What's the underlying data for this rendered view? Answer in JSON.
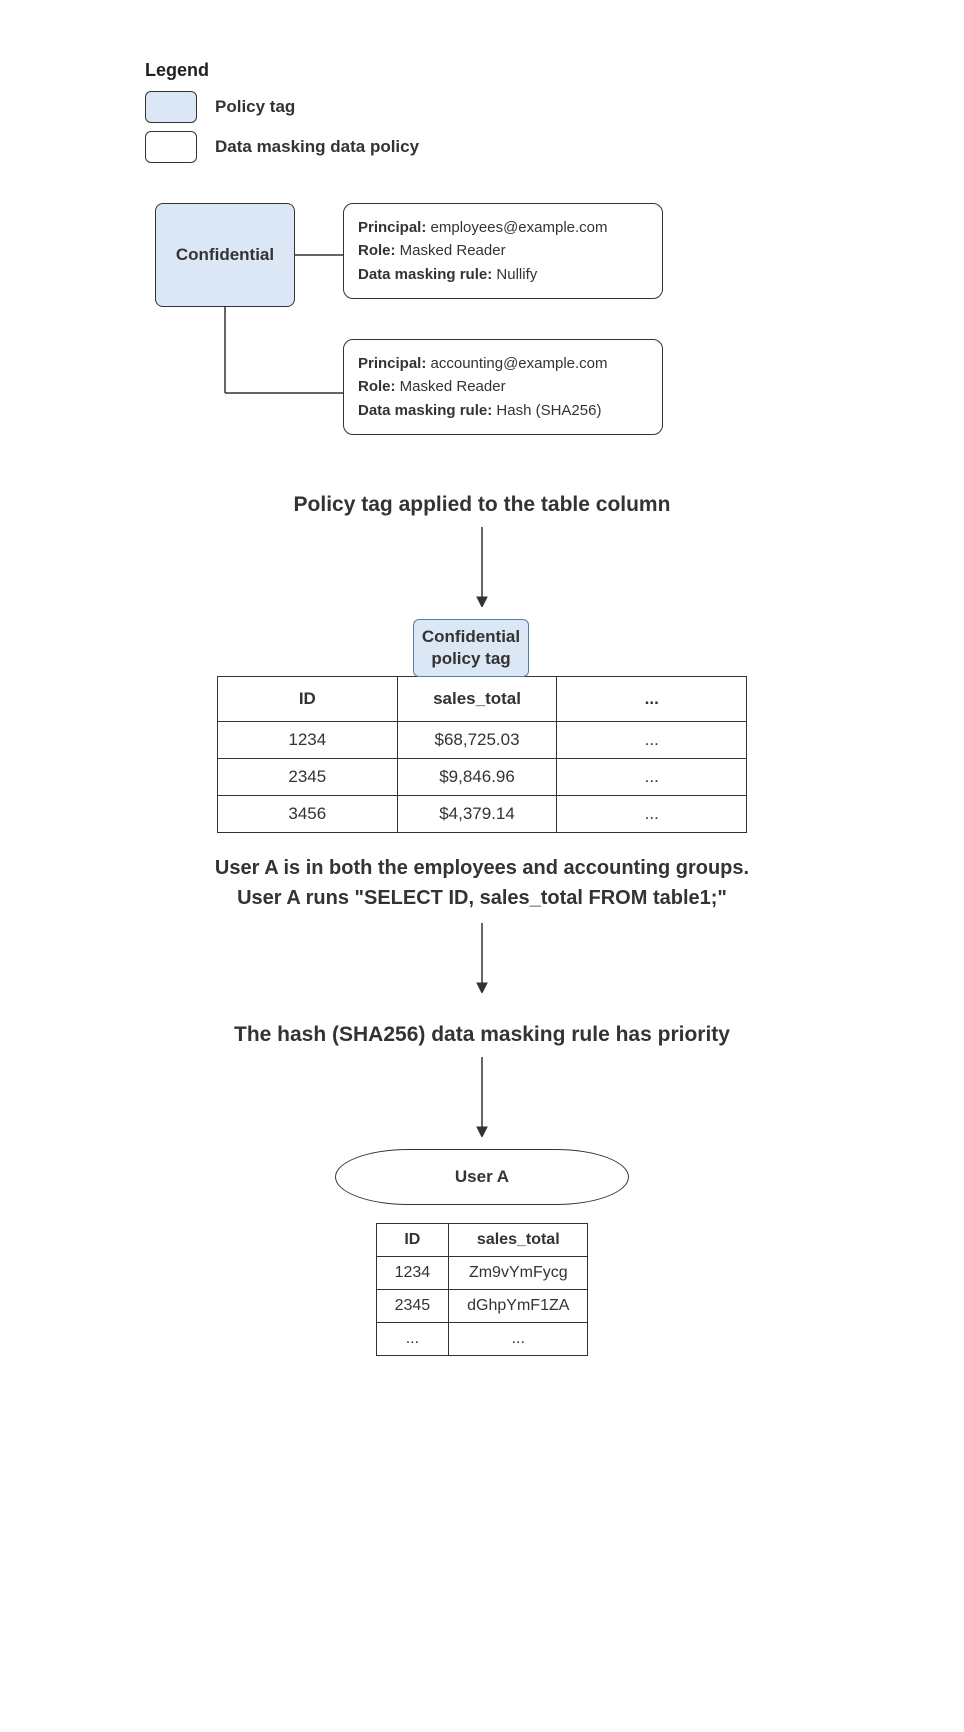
{
  "legend": {
    "title": "Legend",
    "items": [
      {
        "label": "Policy tag",
        "swatch": "blue"
      },
      {
        "label": "Data masking data policy",
        "swatch": "white"
      }
    ]
  },
  "confidential_label": "Confidential",
  "policies": [
    {
      "principal_label": "Principal:",
      "principal": "employees@example.com",
      "role_label": "Role:",
      "role": "Masked Reader",
      "rule_label": "Data masking rule:",
      "rule": "Nullify"
    },
    {
      "principal_label": "Principal:",
      "principal": "accounting@example.com",
      "role_label": "Role:",
      "role": "Masked Reader",
      "rule_label": "Data masking rule:",
      "rule": "Hash (SHA256)"
    }
  ],
  "heading1": "Policy tag applied to the table column",
  "column_tag_line1": "Confidential",
  "column_tag_line2": "policy tag",
  "table1": {
    "headers": [
      "ID",
      "sales_total",
      "..."
    ],
    "rows": [
      [
        "1234",
        "$68,725.03",
        "..."
      ],
      [
        "2345",
        "$9,846.96",
        "..."
      ],
      [
        "3456",
        "$4,379.14",
        "..."
      ]
    ]
  },
  "text_block_line1": "User A is in both the employees and accounting groups.",
  "text_block_line2": "User A runs \"SELECT ID, sales_total FROM table1;\"",
  "heading2": "The hash (SHA256) data masking rule has priority",
  "user_bubble": "User A",
  "table2": {
    "headers": [
      "ID",
      "sales_total"
    ],
    "rows": [
      [
        "1234",
        "Zm9vYmFycg"
      ],
      [
        "2345",
        "dGhpYmF1ZA"
      ],
      [
        "...",
        "..."
      ]
    ]
  }
}
